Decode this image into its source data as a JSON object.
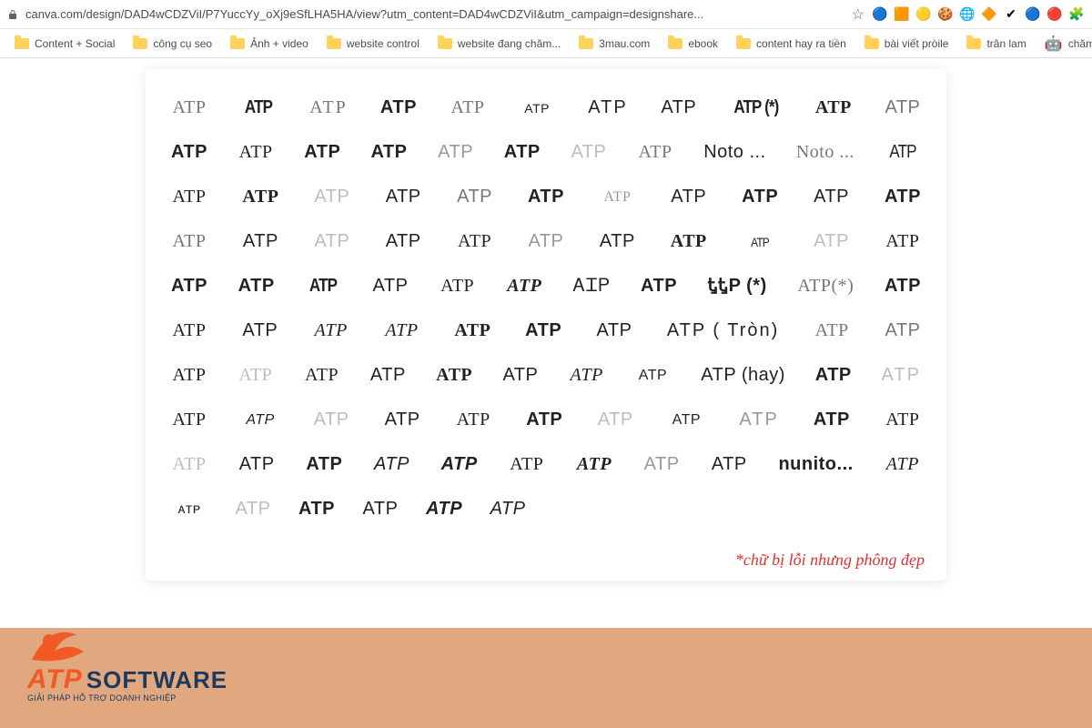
{
  "chrome": {
    "url": "canva.com/design/DAD4wCDZViI/P7YuccYy_oXj9eSfLHA5HA/view?utm_content=DAD4wCDZViI&utm_campaign=designshare...",
    "star": "☆"
  },
  "ext_icons": [
    {
      "glyph": "🔵",
      "name": "ext-1"
    },
    {
      "glyph": "🟧",
      "name": "ext-2"
    },
    {
      "glyph": "🟡",
      "name": "ext-3"
    },
    {
      "glyph": "🍪",
      "name": "ext-4"
    },
    {
      "glyph": "🌐",
      "name": "ext-5"
    },
    {
      "glyph": "🔶",
      "name": "ext-6"
    },
    {
      "glyph": "✔",
      "name": "ext-7"
    },
    {
      "glyph": "🔵",
      "name": "ext-8"
    },
    {
      "glyph": "🔴",
      "name": "ext-9"
    },
    {
      "glyph": "🧩",
      "name": "extensions"
    }
  ],
  "bookmarks": [
    {
      "label": "Content + Social"
    },
    {
      "label": "công cụ seo"
    },
    {
      "label": "Ảnh + video"
    },
    {
      "label": "website control"
    },
    {
      "label": "website đang chăm..."
    },
    {
      "label": "3mau.com"
    },
    {
      "label": "ebook"
    },
    {
      "label": "content hay ra tiền"
    },
    {
      "label": "bài viết pròile"
    },
    {
      "label": "trân lam"
    },
    {
      "label": "chăm w",
      "icon": "kiwi"
    }
  ],
  "rows": [
    [
      {
        "t": "ATP",
        "c": "serif w-light"
      },
      {
        "t": "ATP",
        "c": "w-bold cond"
      },
      {
        "t": "ATP",
        "c": "serif w-light wide"
      },
      {
        "t": "ATP",
        "c": "w-bold"
      },
      {
        "t": "ATP",
        "c": "serif w-light"
      },
      {
        "t": "ATP",
        "c": "xsmall"
      },
      {
        "t": "ATP",
        "c": "wide"
      },
      {
        "t": "ATP",
        "c": ""
      },
      {
        "t": "ATP (*)",
        "c": "w-bold cond"
      },
      {
        "t": "ATP",
        "c": "w-semibold serif"
      },
      {
        "t": "ATP",
        "c": "w-light"
      }
    ],
    [
      {
        "t": "ATP",
        "c": "w-bold"
      },
      {
        "t": "ATP",
        "c": "serif"
      },
      {
        "t": "ATP",
        "c": "w-semibold"
      },
      {
        "t": "ATP",
        "c": "w-bold"
      },
      {
        "t": "ATP",
        "c": "thin"
      },
      {
        "t": "ATP",
        "c": "w-bold"
      },
      {
        "t": "ATP",
        "c": "w-xlight"
      },
      {
        "t": "ATP",
        "c": "serif w-light"
      },
      {
        "t": "Noto ...",
        "c": ""
      },
      {
        "t": "Noto ...",
        "c": "serif w-light"
      },
      {
        "t": "ATP",
        "c": "cond"
      }
    ],
    [
      {
        "t": "ATP",
        "c": "serif"
      },
      {
        "t": "ATP",
        "c": "serif w-bold"
      },
      {
        "t": "ATP",
        "c": "w-xlight"
      },
      {
        "t": "ATP",
        "c": ""
      },
      {
        "t": "ATP",
        "c": "w-light"
      },
      {
        "t": "ATP",
        "c": "w-bold"
      },
      {
        "t": "ATP",
        "c": "serif thin small"
      },
      {
        "t": "ATP",
        "c": ""
      },
      {
        "t": "ATP",
        "c": "w-bold"
      },
      {
        "t": "ATP",
        "c": ""
      },
      {
        "t": "ATP",
        "c": "w-semibold"
      }
    ],
    [
      {
        "t": "ATP",
        "c": "serif w-light"
      },
      {
        "t": "ATP",
        "c": ""
      },
      {
        "t": "ATP",
        "c": "w-xlight"
      },
      {
        "t": "ATP",
        "c": "w-med"
      },
      {
        "t": "ATP",
        "c": "serif"
      },
      {
        "t": "ATP",
        "c": "thin"
      },
      {
        "t": "ATP",
        "c": ""
      },
      {
        "t": "ATP",
        "c": "w-bold serif"
      },
      {
        "t": "ATP",
        "c": "cond xsmall"
      },
      {
        "t": "ATP",
        "c": "w-xlight"
      },
      {
        "t": "ATP",
        "c": "serif"
      }
    ],
    [
      {
        "t": "ATP",
        "c": "w-bold"
      },
      {
        "t": "ATP",
        "c": "w-bold"
      },
      {
        "t": "ATP",
        "c": "w-bold cond"
      },
      {
        "t": "ATP",
        "c": ""
      },
      {
        "t": "ATP",
        "c": "serif"
      },
      {
        "t": "ATP",
        "c": "serif italic w-bold"
      },
      {
        "t": "ᎪᏆᏢ",
        "c": ""
      },
      {
        "t": "ATP",
        "c": "w-bold"
      },
      {
        "t": "ᎿᎿP (*)",
        "c": "w-bold"
      },
      {
        "t": "ATP(*)",
        "c": "serif w-light"
      },
      {
        "t": "ATP",
        "c": "w-bold"
      }
    ],
    [
      {
        "t": "ATP",
        "c": "serif"
      },
      {
        "t": "ATP",
        "c": ""
      },
      {
        "t": "ATP",
        "c": "script"
      },
      {
        "t": "ATP",
        "c": "script"
      },
      {
        "t": "ATP",
        "c": "w-bold serif"
      },
      {
        "t": "ATP",
        "c": "w-bold"
      },
      {
        "t": "ATP",
        "c": ""
      },
      {
        "t": "ATP ( Tròn)",
        "c": "wide"
      },
      {
        "t": "ATP",
        "c": "serif w-light"
      },
      {
        "t": "ATP",
        "c": "w-light"
      }
    ],
    [
      {
        "t": "ATP",
        "c": "serif"
      },
      {
        "t": "ATP",
        "c": "w-xlight serif"
      },
      {
        "t": "ATP",
        "c": "serif"
      },
      {
        "t": "ATP",
        "c": ""
      },
      {
        "t": "ATP",
        "c": "w-bold serif"
      },
      {
        "t": "ATP",
        "c": ""
      },
      {
        "t": "ATP",
        "c": "script"
      },
      {
        "t": "ATP",
        "c": "small sc"
      },
      {
        "t": "ATP (hay)",
        "c": ""
      },
      {
        "t": "ATP",
        "c": "w-semibold"
      },
      {
        "t": "ATP",
        "c": "w-xlight wide"
      }
    ],
    [
      {
        "t": "ATP",
        "c": "serif"
      },
      {
        "t": "ATP",
        "c": "small italic"
      },
      {
        "t": "ATP",
        "c": "w-xlight"
      },
      {
        "t": "ATP",
        "c": ""
      },
      {
        "t": "ATP",
        "c": "serif"
      },
      {
        "t": "ATP",
        "c": "w-bold"
      },
      {
        "t": "ATP",
        "c": "w-xlight"
      },
      {
        "t": "ATP",
        "c": "small"
      },
      {
        "t": "ATP",
        "c": "thin wide"
      },
      {
        "t": "ATP",
        "c": "w-bold"
      },
      {
        "t": "ATP",
        "c": "serif"
      }
    ],
    [
      {
        "t": "ATP",
        "c": "w-xlight serif"
      },
      {
        "t": "ATP",
        "c": ""
      },
      {
        "t": "ATP",
        "c": "w-semibold"
      },
      {
        "t": "ATP",
        "c": "italic"
      },
      {
        "t": "ATP",
        "c": "w-bold italic"
      },
      {
        "t": "ATP",
        "c": "serif"
      },
      {
        "t": "ATP",
        "c": "script w-bold"
      },
      {
        "t": "ATP",
        "c": "thin"
      },
      {
        "t": "ATP",
        "c": ""
      },
      {
        "t": "nunito...",
        "c": "w-bold"
      },
      {
        "t": "ATP",
        "c": "script"
      }
    ],
    [
      {
        "t": "ᴀᴛᴩ",
        "c": "small"
      },
      {
        "t": "ATP",
        "c": "w-xlight"
      },
      {
        "t": "ATP",
        "c": "w-semibold"
      },
      {
        "t": "ATP",
        "c": "sc"
      },
      {
        "t": "ATP",
        "c": "w-bold italic"
      },
      {
        "t": "ATP",
        "c": "italic"
      }
    ]
  ],
  "note": "*chữ bị lỗi nhưng phông đẹp",
  "brand": {
    "atp": "ATP",
    "software": "SOFTWARE",
    "sub": "GIẢI PHÁP HỖ TRỢ DOANH NGHIỆP"
  }
}
